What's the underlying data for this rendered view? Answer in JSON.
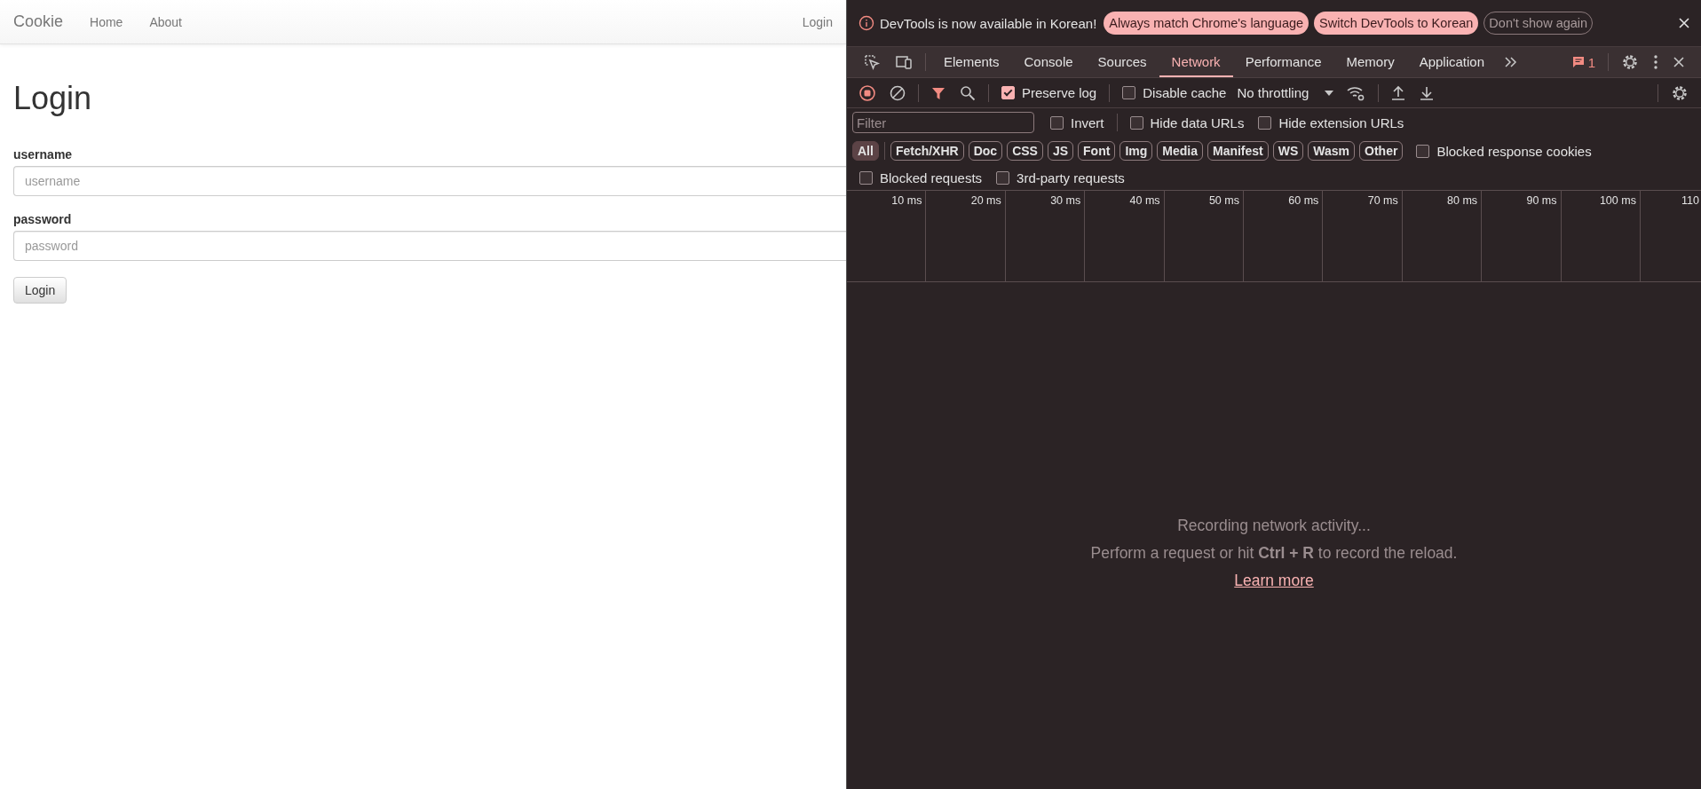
{
  "page": {
    "brand": "Cookie",
    "nav_links": [
      "Home",
      "About"
    ],
    "nav_right": "Login",
    "heading": "Login",
    "fields": [
      {
        "label": "username",
        "placeholder": "username"
      },
      {
        "label": "password",
        "placeholder": "password"
      }
    ],
    "submit": "Login"
  },
  "devtools": {
    "infobar": {
      "message": "DevTools is now available in Korean!",
      "buttons": [
        {
          "label": "Always match Chrome's language",
          "kind": "primary"
        },
        {
          "label": "Switch DevTools to Korean",
          "kind": "primary"
        },
        {
          "label": "Don't show again",
          "kind": "outline"
        }
      ]
    },
    "tabs": [
      {
        "label": "Elements",
        "selected": false
      },
      {
        "label": "Console",
        "selected": false
      },
      {
        "label": "Sources",
        "selected": false
      },
      {
        "label": "Network",
        "selected": true
      },
      {
        "label": "Performance",
        "selected": false
      },
      {
        "label": "Memory",
        "selected": false
      },
      {
        "label": "Application",
        "selected": false
      }
    ],
    "issues_count": "1",
    "toolbar": {
      "preserve_log": {
        "label": "Preserve log",
        "checked": true
      },
      "disable_cache": {
        "label": "Disable cache",
        "checked": false
      },
      "throttling": "No throttling"
    },
    "filter": {
      "placeholder": "Filter"
    },
    "filter_options": [
      {
        "label": "Invert",
        "checked": false
      },
      {
        "label": "Hide data URLs",
        "checked": false
      },
      {
        "label": "Hide extension URLs",
        "checked": false
      }
    ],
    "type_filters": [
      {
        "label": "All",
        "selected": true
      },
      {
        "label": "Fetch/XHR",
        "selected": false
      },
      {
        "label": "Doc",
        "selected": false
      },
      {
        "label": "CSS",
        "selected": false
      },
      {
        "label": "JS",
        "selected": false
      },
      {
        "label": "Font",
        "selected": false
      },
      {
        "label": "Img",
        "selected": false
      },
      {
        "label": "Media",
        "selected": false
      },
      {
        "label": "Manifest",
        "selected": false
      },
      {
        "label": "WS",
        "selected": false
      },
      {
        "label": "Wasm",
        "selected": false
      },
      {
        "label": "Other",
        "selected": false
      }
    ],
    "blocked_cookies": {
      "label": "Blocked response cookies",
      "checked": false
    },
    "request_options": [
      {
        "label": "Blocked requests",
        "checked": false
      },
      {
        "label": "3rd-party requests",
        "checked": false
      }
    ],
    "timeline_ticks": [
      "10 ms",
      "20 ms",
      "30 ms",
      "40 ms",
      "50 ms",
      "60 ms",
      "70 ms",
      "80 ms",
      "90 ms",
      "100 ms",
      "110"
    ],
    "empty_state": {
      "title": "Recording network activity...",
      "hint": "Perform a request or hit **Ctrl + R** to record the reload.",
      "link": "Learn more"
    }
  }
}
